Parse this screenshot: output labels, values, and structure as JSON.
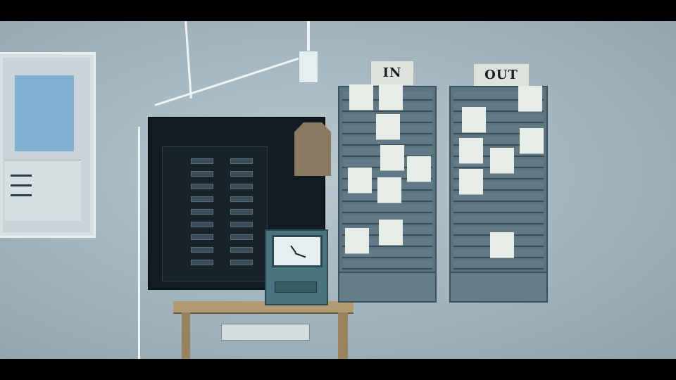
{
  "scene": {
    "signs": {
      "in_label": "IN",
      "out_label": "OUT"
    }
  }
}
